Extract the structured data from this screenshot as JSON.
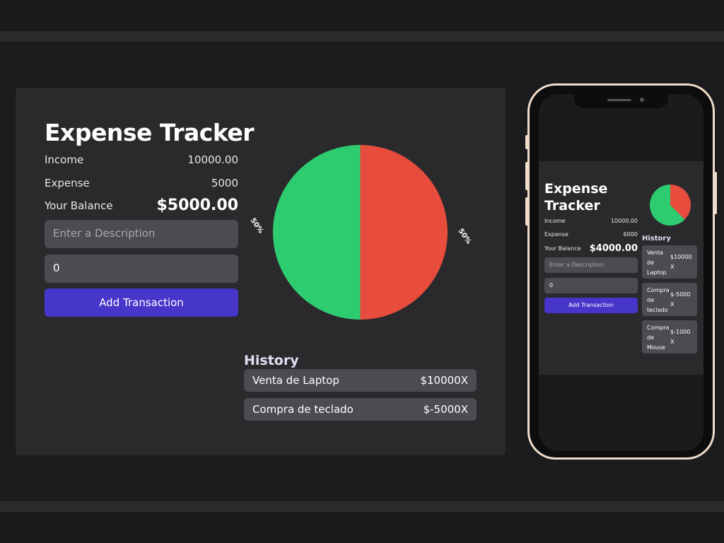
{
  "desktop": {
    "title": "Expense Tracker",
    "income_label": "Income",
    "income_value": "10000.00",
    "expense_label": "Expense",
    "expense_value": "5000",
    "balance_label": "Your Balance",
    "balance_value": "$5000.00",
    "description_placeholder": "Enter a Description",
    "amount_value": "0",
    "add_button": "Add Transaction",
    "pie_left_label": "50%",
    "pie_right_label": "50%",
    "history_title": "History",
    "history": [
      {
        "description": "Venta de Laptop",
        "amount": "$10000X"
      },
      {
        "description": "Compra de teclado",
        "amount": "$-5000X"
      }
    ]
  },
  "mobile": {
    "title": "Expense Tracker",
    "income_label": "Income",
    "income_value": "10000.00",
    "expense_label": "Expense",
    "expense_value": "6000",
    "balance_label": "Your Balance",
    "balance_value": "$4000.00",
    "description_placeholder": "Enter a Description",
    "amount_value": "0",
    "add_button": "Add Transaction",
    "history_title": "History",
    "history": [
      {
        "description": "Venta de Laptop",
        "amount": "$10000 X"
      },
      {
        "description": "Compra de teclado",
        "amount": "$-5000 X"
      },
      {
        "description": "Compra de Mouse",
        "amount": "$-1000 X"
      }
    ]
  },
  "chart_data": [
    {
      "type": "pie",
      "labels": [
        "Income",
        "Expense"
      ],
      "values": [
        10000,
        5000
      ],
      "slice_labels": [
        "50%",
        "50%"
      ],
      "colors": [
        "#2ecc71",
        "#e74c3c"
      ]
    },
    {
      "type": "pie",
      "labels": [
        "Income",
        "Expense"
      ],
      "values": [
        10000,
        6000
      ],
      "colors": [
        "#2ecc71",
        "#e74c3c"
      ]
    }
  ]
}
